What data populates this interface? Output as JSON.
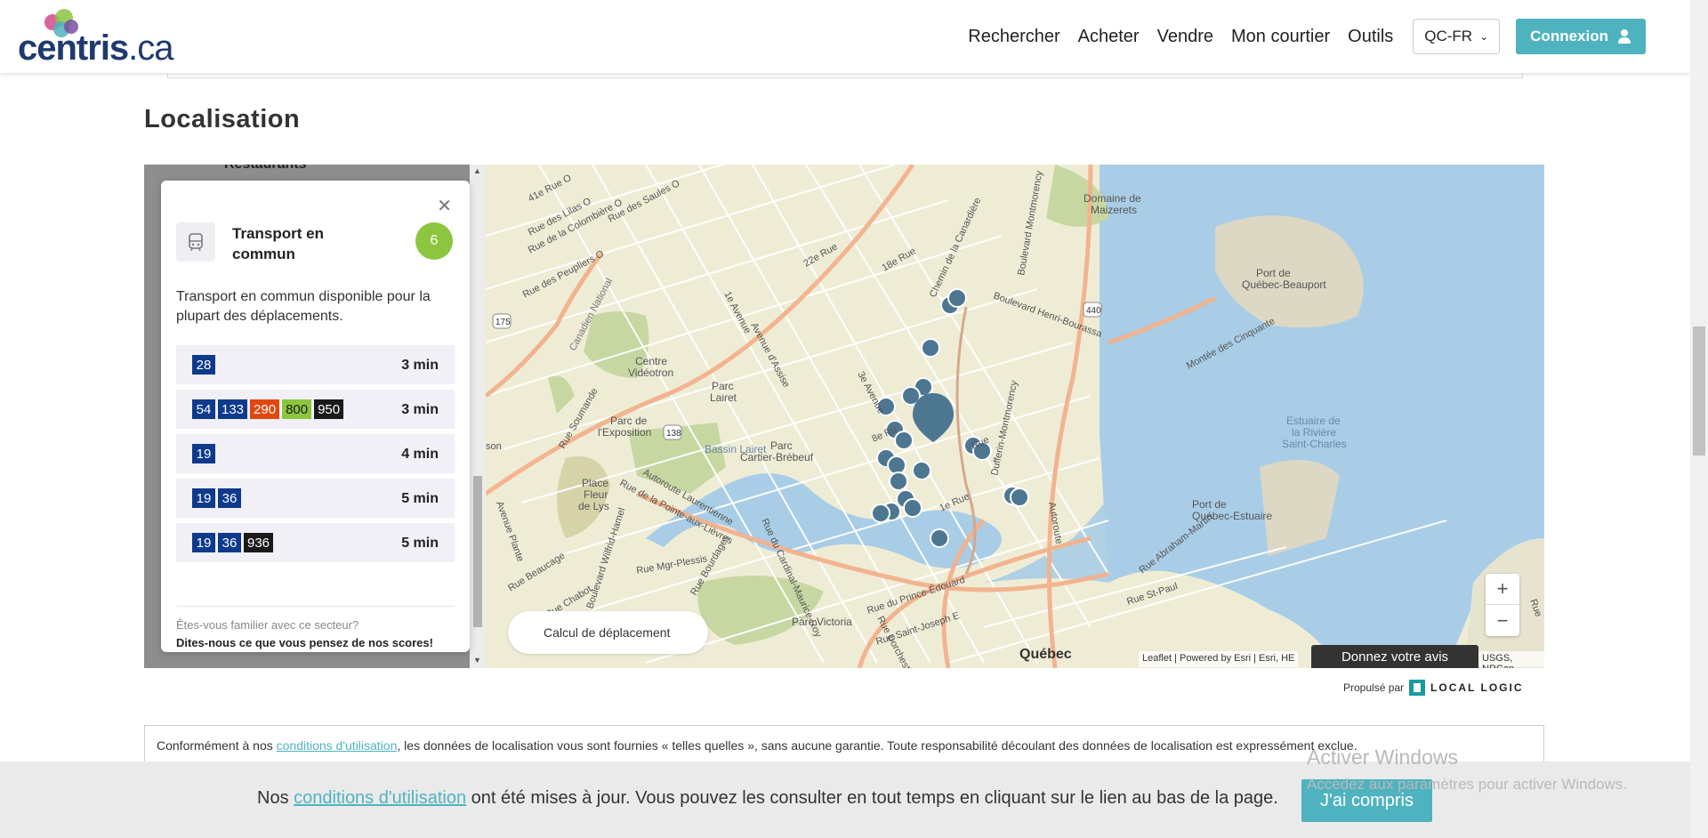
{
  "header": {
    "logo_text": "centris",
    "logo_suffix": ".ca",
    "nav": [
      "Rechercher",
      "Acheter",
      "Vendre",
      "Mon courtier",
      "Outils"
    ],
    "language": "QC-FR",
    "login_label": "Connexion"
  },
  "section": {
    "title": "Localisation"
  },
  "panel": {
    "peek_label": "Restaurants",
    "card": {
      "title": "Transport en commun",
      "score": "6",
      "description": "Transport en commun disponible pour la plupart des déplacements.",
      "routes": [
        {
          "badges": [
            {
              "num": "28",
              "color": "#0e3a8c"
            }
          ],
          "time": "3 min"
        },
        {
          "badges": [
            {
              "num": "54",
              "color": "#0e3a8c"
            },
            {
              "num": "133",
              "color": "#0e3a8c"
            },
            {
              "num": "290",
              "color": "#e2470e"
            },
            {
              "num": "800",
              "color": "#8cc63f"
            },
            {
              "num": "950",
              "color": "#1a1a1a"
            }
          ],
          "time": "3 min"
        },
        {
          "badges": [
            {
              "num": "19",
              "color": "#0e3a8c"
            }
          ],
          "time": "4 min"
        },
        {
          "badges": [
            {
              "num": "19",
              "color": "#0e3a8c"
            },
            {
              "num": "36",
              "color": "#0e3a8c"
            }
          ],
          "time": "5 min"
        },
        {
          "badges": [
            {
              "num": "19",
              "color": "#0e3a8c"
            },
            {
              "num": "36",
              "color": "#0e3a8c"
            },
            {
              "num": "936",
              "color": "#1a1a1a"
            }
          ],
          "time": "5 min"
        }
      ],
      "question": "Êtes-vous familier avec ce secteur?",
      "cta": "Dites-nous ce que vous pensez de nos scores!"
    }
  },
  "map": {
    "calc_label": "Calcul de déplacement",
    "attribution": "Leaflet | Powered by Esri | Esri, HE",
    "attribution_right": "USGS, NRCan",
    "feedback_label": "Donnez votre avis",
    "labels": {
      "quebec": "Québec",
      "estuaire": [
        "Estuaire de",
        "la Rivière",
        "Saint-Charles"
      ],
      "port_beauport": [
        "Port de",
        "Québec-Beauport"
      ],
      "port_estuaire": [
        "Port de",
        "Québec-Estuaire"
      ],
      "domaine": [
        "Domaine de",
        "Maizerets"
      ],
      "centre_videotron": [
        "Centre",
        "Vidéotron"
      ],
      "parc_lairet": [
        "Parc",
        "Lairet"
      ],
      "parc_expo": [
        "Parc de",
        "l'Exposition"
      ],
      "parc_cartier": [
        "Parc",
        "Cartier-Brébeuf"
      ],
      "bassin": "Bassin Lairet",
      "place_fleur": [
        "Place",
        "Fleur",
        "de Lys"
      ],
      "parc_victoria": "Parc Victoria",
      "canadien_national": "Canadien National",
      "streets": {
        "r41": "41e Rue O",
        "lilas": "Rue des Lilas O",
        "colombiere": "Rue de la Colombière O",
        "saules": "Rue des Saules O",
        "peupliers": "Rue des Peupliers O",
        "r22": "22e Rue",
        "r18": "18e Rue",
        "canardiere": "Chemin de la Canardière",
        "bd_montmorency": "Boulevard Montmorency",
        "henri_bourassa": "Boulevard Henri-Bourassa",
        "cinquante": "Montée des Cinquante",
        "av1": "1e Avenue",
        "assise": "Avenue d'Assise",
        "av3": "3e Avenue",
        "dufferin": "Dufferin-Montmorency",
        "soumande": "Rue Soumande",
        "laurentienne": "Autoroute Laurentienne",
        "pointe": "Rue de la Pointe-aux-Lièvres",
        "cardinal": "Rue du Cardinal-Maurice-Roy",
        "wilfrid": "Boulevard Wilfrid-Hamel",
        "plante": "Avenue Plante",
        "beaucage": "Rue Beaucage",
        "chabot": "Rue Chabot",
        "mgr_plessis": "Rue Mgr-Plessis",
        "bourdages": "Rue Bourdages",
        "prince_edouard": "Rue du Prince-Édouard",
        "saint_joseph": "Rue Saint-Joseph E",
        "dorchester": "Rue Dorchester",
        "st_paul": "Rue St-Paul",
        "abraham": "Rue Abraham-Martin",
        "r1": "1e Rue",
        "r8": "8e Ru",
        "axe": "Autoroute",
        "route175": "175",
        "route440": "440",
        "route138": "138",
        "rue_frag": "Rue",
        "son_frag": "son",
        "rue_right": "Rue"
      }
    }
  },
  "powered_by": {
    "label": "Propulsé par",
    "brand": "LOCAL LOGIC"
  },
  "disclaimer": {
    "before": "Conformément à nos ",
    "link": "conditions d'utilisation",
    "after": ", les données de localisation vous sont fournies « telles quelles », sans aucune garantie. Toute responsabilité découlant des données de localisation est expressément exclue."
  },
  "cookie": {
    "before": "Nos ",
    "link": "conditions d'utilisation",
    "after": " ont été mises à jour. Vous pouvez les consulter en tout temps en cliquant sur le lien au bas de la page.",
    "button": "J'ai compris"
  },
  "watermark": {
    "title": "Activer Windows",
    "subtitle": "Accédez aux paramètres pour activer Windows."
  }
}
